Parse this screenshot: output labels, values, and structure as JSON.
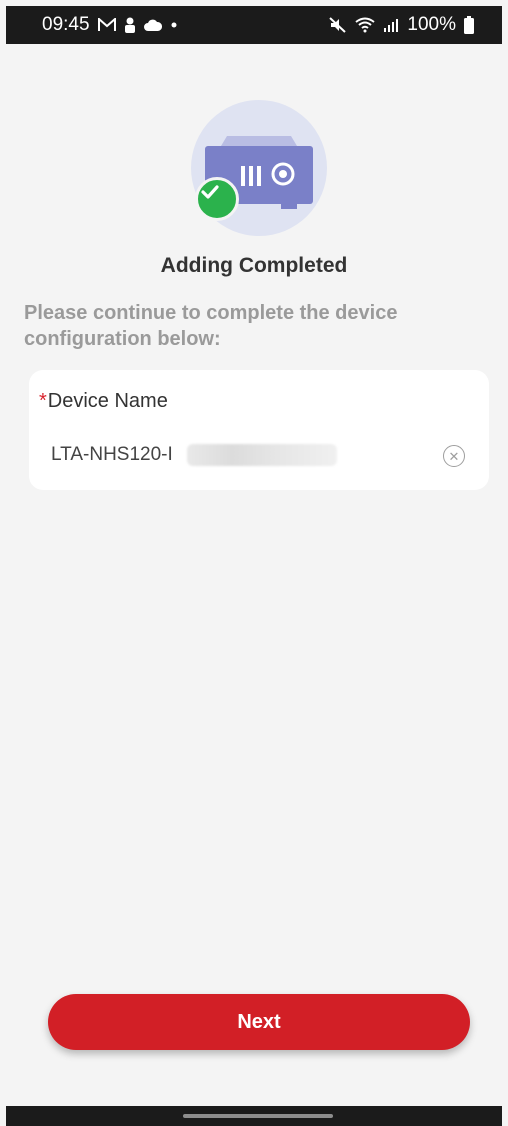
{
  "status_bar": {
    "time": "09:45",
    "battery": "100%",
    "left_icons": [
      "mail-icon",
      "person-icon",
      "cloud-icon",
      "dot-icon"
    ],
    "right_icons": [
      "mute-icon",
      "wifi-icon",
      "signal-icon",
      "battery-icon"
    ]
  },
  "hero": {
    "icon": "nvr-device-icon",
    "badge_icon": "check-icon",
    "colors": {
      "circle": "#dfe3f2",
      "device": "#7a80c8",
      "badge": "#2bb24c"
    }
  },
  "title": "Adding Completed",
  "instruction": "Please continue to complete the device configuration below:",
  "form": {
    "required_marker": "*",
    "device_name_label": "Device Name",
    "device_name_value": "LTA-NHS120-I",
    "clear_icon": "clear-icon"
  },
  "actions": {
    "next_label": "Next",
    "accent": "#d21f26"
  }
}
